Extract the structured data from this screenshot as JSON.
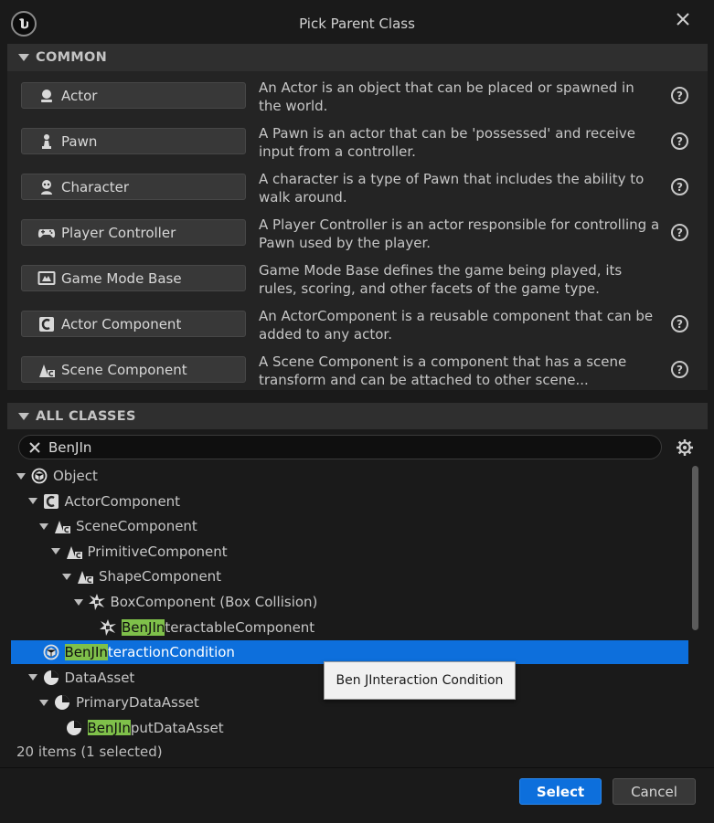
{
  "window": {
    "title": "Pick Parent Class",
    "close_icon": "close-icon",
    "logo_icon": "unreal-logo-icon"
  },
  "common": {
    "header": "COMMON",
    "items": [
      {
        "label": "Actor",
        "icon": "actor-icon",
        "description": "An Actor is an object that can be placed or spawned in the world."
      },
      {
        "label": "Pawn",
        "icon": "pawn-icon",
        "description": "A Pawn is an actor that can be 'possessed' and receive input from a controller."
      },
      {
        "label": "Character",
        "icon": "character-icon",
        "description": "A character is a type of Pawn that includes the ability to walk around."
      },
      {
        "label": "Player Controller",
        "icon": "gamepad-icon",
        "description": "A Player Controller is an actor responsible for controlling a Pawn used by the player."
      },
      {
        "label": "Game Mode Base",
        "icon": "game-mode-icon",
        "description": "Game Mode Base defines the game being played, its rules, scoring, and other facets of the game type."
      },
      {
        "label": "Actor Component",
        "icon": "actor-component-icon",
        "description": "An ActorComponent is a reusable component that can be added to any actor."
      },
      {
        "label": "Scene Component",
        "icon": "scene-component-icon",
        "description": "A Scene Component is a component that has a scene transform and can be attached to other scene..."
      }
    ]
  },
  "all_classes": {
    "header": "ALL CLASSES",
    "search": {
      "value": "BenJIn",
      "placeholder": ""
    },
    "tree": [
      {
        "label_pre": "",
        "label_hl": "",
        "label_post": "Object",
        "icon": "object-icon",
        "depth": 0,
        "expanded": true,
        "selected": false
      },
      {
        "label_pre": "",
        "label_hl": "",
        "label_post": "ActorComponent",
        "icon": "actor-component-icon",
        "depth": 1,
        "expanded": true,
        "selected": false
      },
      {
        "label_pre": "",
        "label_hl": "",
        "label_post": "SceneComponent",
        "icon": "scene-component-icon",
        "depth": 2,
        "expanded": true,
        "selected": false
      },
      {
        "label_pre": "",
        "label_hl": "",
        "label_post": "PrimitiveComponent",
        "icon": "scene-component-icon",
        "depth": 3,
        "expanded": true,
        "selected": false
      },
      {
        "label_pre": "",
        "label_hl": "",
        "label_post": "ShapeComponent",
        "icon": "scene-component-icon",
        "depth": 4,
        "expanded": true,
        "selected": false
      },
      {
        "label_pre": "",
        "label_hl": "",
        "label_post": "BoxComponent (Box Collision)",
        "icon": "box-collision-icon",
        "depth": 5,
        "expanded": true,
        "selected": false
      },
      {
        "label_pre": "",
        "label_hl": "BenJIn",
        "label_post": "teractableComponent",
        "icon": "box-collision-icon",
        "depth": 6,
        "expanded": false,
        "selected": false
      },
      {
        "label_pre": "",
        "label_hl": "BenJIn",
        "label_post": "teractionCondition",
        "icon": "object-icon",
        "depth": 1,
        "expanded": false,
        "selected": true
      },
      {
        "label_pre": "",
        "label_hl": "",
        "label_post": "DataAsset",
        "icon": "data-asset-icon",
        "depth": 1,
        "expanded": true,
        "selected": false
      },
      {
        "label_pre": "",
        "label_hl": "",
        "label_post": "PrimaryDataAsset",
        "icon": "data-asset-icon",
        "depth": 2,
        "expanded": true,
        "selected": false
      },
      {
        "label_pre": "",
        "label_hl": "BenJIn",
        "label_post": "putDataAsset",
        "icon": "data-asset-icon",
        "depth": 3,
        "expanded": false,
        "selected": false
      }
    ],
    "status": "20 items (1 selected)",
    "tooltip": "Ben JInteraction Condition"
  },
  "footer": {
    "select_label": "Select",
    "cancel_label": "Cancel"
  },
  "colors": {
    "accent": "#0d6fdc",
    "highlight": "#7fc04a",
    "background": "#1a1a1a",
    "panel": "#242424"
  }
}
